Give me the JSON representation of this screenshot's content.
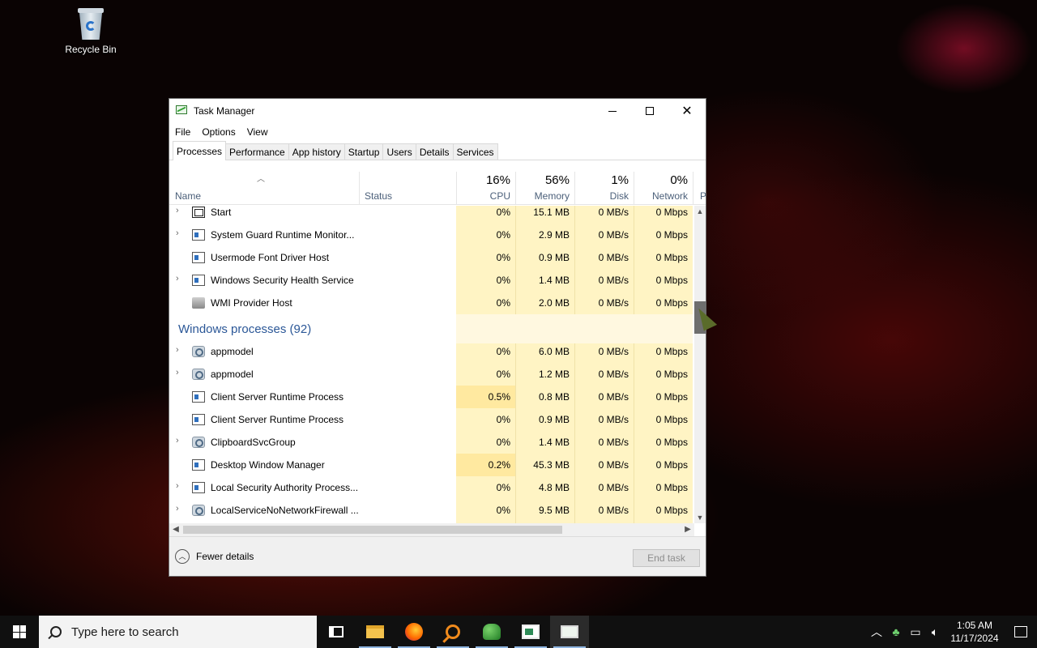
{
  "desktop": {
    "recycle_bin_label": "Recycle Bin"
  },
  "window": {
    "title": "Task Manager",
    "menu": [
      "File",
      "Options",
      "View"
    ],
    "tabs": [
      "Processes",
      "Performance",
      "App history",
      "Startup",
      "Users",
      "Details",
      "Services"
    ],
    "active_tab": "Processes"
  },
  "header": {
    "name": "Name",
    "status": "Status",
    "cpu_pct": "16%",
    "cpu_label": "CPU",
    "mem_pct": "56%",
    "mem_label": "Memory",
    "disk_pct": "1%",
    "disk_label": "Disk",
    "net_pct": "0%",
    "net_label": "Network",
    "power_label": "P"
  },
  "rows_top": [
    {
      "name": "Start",
      "cpu": "0%",
      "mem": "15.1 MB",
      "disk": "0 MB/s",
      "net": "0 Mbps",
      "expand": "›",
      "icon": "start-icon"
    },
    {
      "name": "System Guard Runtime Monitor...",
      "cpu": "0%",
      "mem": "2.9 MB",
      "disk": "0 MB/s",
      "net": "0 Mbps",
      "expand": "›",
      "icon": "window-icon"
    },
    {
      "name": "Usermode Font Driver Host",
      "cpu": "0%",
      "mem": "0.9 MB",
      "disk": "0 MB/s",
      "net": "0 Mbps",
      "expand": "",
      "icon": "window-icon"
    },
    {
      "name": "Windows Security Health Service",
      "cpu": "0%",
      "mem": "1.4 MB",
      "disk": "0 MB/s",
      "net": "0 Mbps",
      "expand": "›",
      "icon": "window-icon"
    },
    {
      "name": "WMI Provider Host",
      "cpu": "0%",
      "mem": "2.0 MB",
      "disk": "0 MB/s",
      "net": "0 Mbps",
      "expand": "",
      "icon": "wmi-icon"
    }
  ],
  "group": {
    "title": "Windows processes (92)"
  },
  "rows_bottom": [
    {
      "name": "appmodel",
      "cpu": "0%",
      "mem": "6.0 MB",
      "disk": "0 MB/s",
      "net": "0 Mbps",
      "expand": "›",
      "icon": "gear-icon"
    },
    {
      "name": "appmodel",
      "cpu": "0%",
      "mem": "1.2 MB",
      "disk": "0 MB/s",
      "net": "0 Mbps",
      "expand": "›",
      "icon": "gear-icon"
    },
    {
      "name": "Client Server Runtime Process",
      "cpu": "0.5%",
      "mem": "0.8 MB",
      "disk": "0 MB/s",
      "net": "0 Mbps",
      "expand": "",
      "icon": "window-icon"
    },
    {
      "name": "Client Server Runtime Process",
      "cpu": "0%",
      "mem": "0.9 MB",
      "disk": "0 MB/s",
      "net": "0 Mbps",
      "expand": "",
      "icon": "window-icon"
    },
    {
      "name": "ClipboardSvcGroup",
      "cpu": "0%",
      "mem": "1.4 MB",
      "disk": "0 MB/s",
      "net": "0 Mbps",
      "expand": "›",
      "icon": "gear-icon"
    },
    {
      "name": "Desktop Window Manager",
      "cpu": "0.2%",
      "mem": "45.3 MB",
      "disk": "0 MB/s",
      "net": "0 Mbps",
      "expand": "",
      "icon": "window-icon"
    },
    {
      "name": "Local Security Authority Process...",
      "cpu": "0%",
      "mem": "4.8 MB",
      "disk": "0 MB/s",
      "net": "0 Mbps",
      "expand": "›",
      "icon": "window-icon"
    },
    {
      "name": "LocalServiceNoNetworkFirewall ...",
      "cpu": "0%",
      "mem": "9.5 MB",
      "disk": "0 MB/s",
      "net": "0 Mbps",
      "expand": "›",
      "icon": "gear-icon"
    }
  ],
  "footer": {
    "fewer_details": "Fewer details",
    "end_task": "End task"
  },
  "taskbar": {
    "search_placeholder": "Type here to search",
    "time": "1:05 AM",
    "date": "11/17/2024",
    "tray_icons": [
      "chevron-up-icon",
      "app-tray-icon",
      "network-icon",
      "volume-icon"
    ]
  }
}
